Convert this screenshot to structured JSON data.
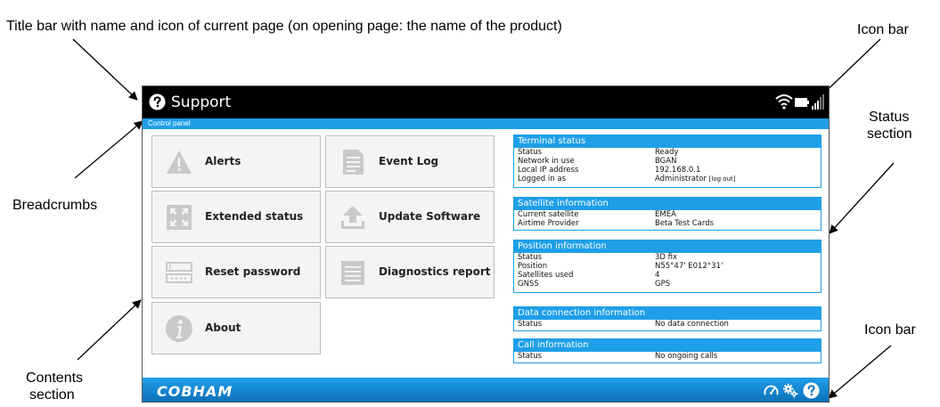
{
  "annotations": {
    "title_bar_note": "Title bar with name and icon of current page (on opening page: the name of the product)",
    "icon_bar_top": "Icon bar",
    "status_section_line1": "Status",
    "status_section_line2": "section",
    "breadcrumbs": "Breadcrumbs",
    "contents_section_line1": "Contents",
    "contents_section_line2": "section",
    "icon_bar_bottom": "Icon bar"
  },
  "titlebar": {
    "title": "Support",
    "icon": "help-icon",
    "status_icons": [
      "wifi-icon",
      "battery-icon",
      "signal-icon"
    ]
  },
  "breadcrumb": {
    "text": "Control panel"
  },
  "tiles": {
    "alerts": {
      "label": "Alerts",
      "icon": "warning-icon"
    },
    "event_log": {
      "label": "Event Log",
      "icon": "document-icon"
    },
    "extended_status": {
      "label": "Extended status",
      "icon": "expand-icon"
    },
    "update_software": {
      "label": "Update Software",
      "icon": "upload-icon"
    },
    "reset_password": {
      "label": "Reset password",
      "icon": "password-icon"
    },
    "diagnostics_report": {
      "label": "Diagnostics report",
      "icon": "report-icon"
    },
    "about": {
      "label": "About",
      "icon": "info-icon"
    }
  },
  "status": {
    "terminal": {
      "title": "Terminal status",
      "rows": [
        {
          "k": "Status",
          "v": "Ready"
        },
        {
          "k": "Network in use",
          "v": "BGAN"
        },
        {
          "k": "Local IP address",
          "v": "192.168.0.1"
        },
        {
          "k": "Logged in as",
          "v": "Administrator",
          "link": "[log out]"
        }
      ]
    },
    "satellite": {
      "title": "Satellite information",
      "rows": [
        {
          "k": "Current satellite",
          "v": "EMEA"
        },
        {
          "k": "Airtime Provider",
          "v": "Beta Test Cards"
        }
      ]
    },
    "position": {
      "title": "Position information",
      "rows": [
        {
          "k": "Status",
          "v": "3D fix"
        },
        {
          "k": "Position",
          "v": "N55°47' E012°31'"
        },
        {
          "k": "Satellites used",
          "v": "4"
        },
        {
          "k": "GNSS",
          "v": "GPS"
        }
      ]
    },
    "data_connection": {
      "title": "Data connection information",
      "rows": [
        {
          "k": "Status",
          "v": "No data connection"
        }
      ]
    },
    "call": {
      "title": "Call information",
      "rows": [
        {
          "k": "Status",
          "v": "No ongoing calls"
        }
      ]
    }
  },
  "footer": {
    "logo": "COBHAM",
    "icons": [
      "dashboard-icon",
      "settings-icon",
      "help-icon"
    ]
  },
  "colors": {
    "accent": "#1e9fe8",
    "titlebar": "#000000",
    "tile_bg": "#f4f4f4"
  }
}
